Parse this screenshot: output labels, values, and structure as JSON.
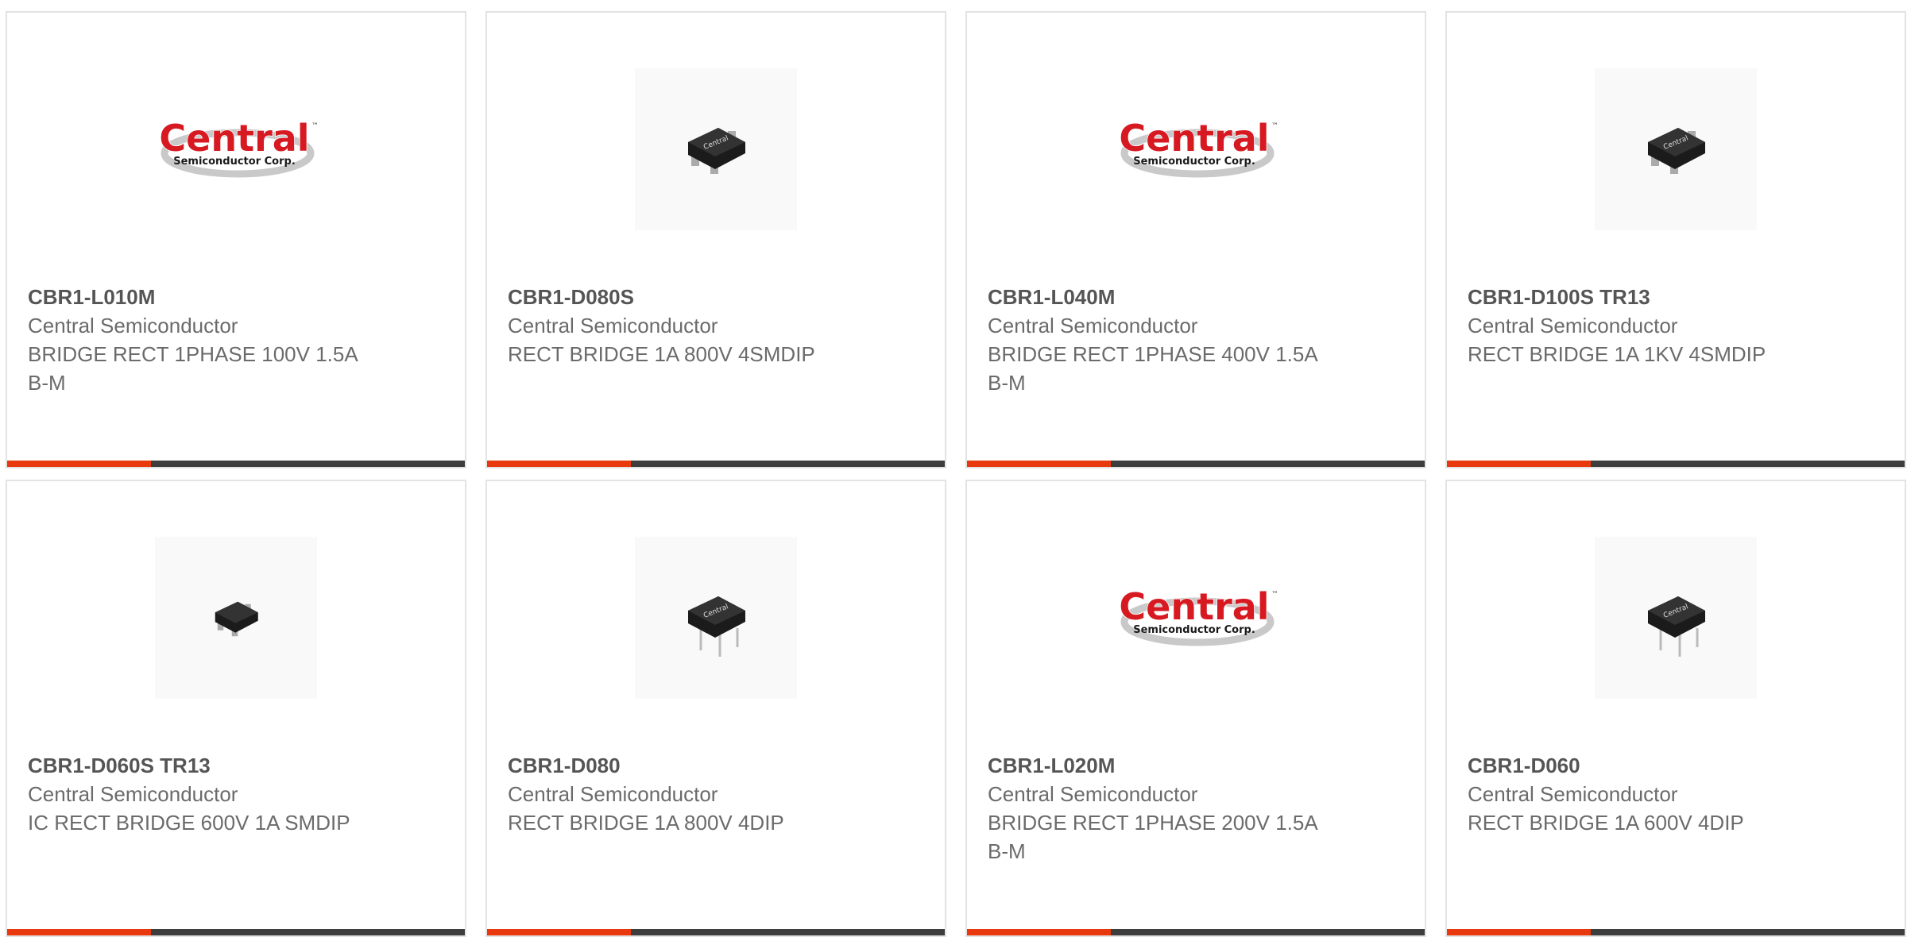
{
  "colors": {
    "accent": "#e8380d",
    "bar": "#3d3d3d",
    "logo_red": "#d71921",
    "logo_gray": "#c9c9c9",
    "chip_body": "#1b1b1b"
  },
  "logo": {
    "word": "Central",
    "tm": "™",
    "sub": "Semiconductor Corp."
  },
  "chip_mark": "Central",
  "products": [
    {
      "image": "central-logo",
      "part": "CBR1-L010M",
      "manufacturer": "Central Semiconductor",
      "description": "BRIDGE RECT 1PHASE 100V 1.5A B-M"
    },
    {
      "image": "smdip-chip",
      "part": "CBR1-D080S",
      "manufacturer": "Central Semiconductor",
      "description": "RECT BRIDGE 1A 800V 4SMDIP"
    },
    {
      "image": "central-logo",
      "part": "CBR1-L040M",
      "manufacturer": "Central Semiconductor",
      "description": "BRIDGE RECT 1PHASE 400V 1.5A B-M"
    },
    {
      "image": "smdip-chip",
      "part": "CBR1-D100S TR13",
      "manufacturer": "Central Semiconductor",
      "description": "RECT BRIDGE 1A 1KV 4SMDIP"
    },
    {
      "image": "small-chip",
      "part": "CBR1-D060S TR13",
      "manufacturer": "Central Semiconductor",
      "description": "IC RECT BRIDGE 600V 1A SMDIP"
    },
    {
      "image": "dip-chip",
      "part": "CBR1-D080",
      "manufacturer": "Central Semiconductor",
      "description": "RECT BRIDGE 1A 800V 4DIP"
    },
    {
      "image": "central-logo",
      "part": "CBR1-L020M",
      "manufacturer": "Central Semiconductor",
      "description": "BRIDGE RECT 1PHASE 200V 1.5A B-M"
    },
    {
      "image": "dip-chip",
      "part": "CBR1-D060",
      "manufacturer": "Central Semiconductor",
      "description": "RECT BRIDGE 1A 600V 4DIP"
    }
  ],
  "accent_fraction": 0.315
}
